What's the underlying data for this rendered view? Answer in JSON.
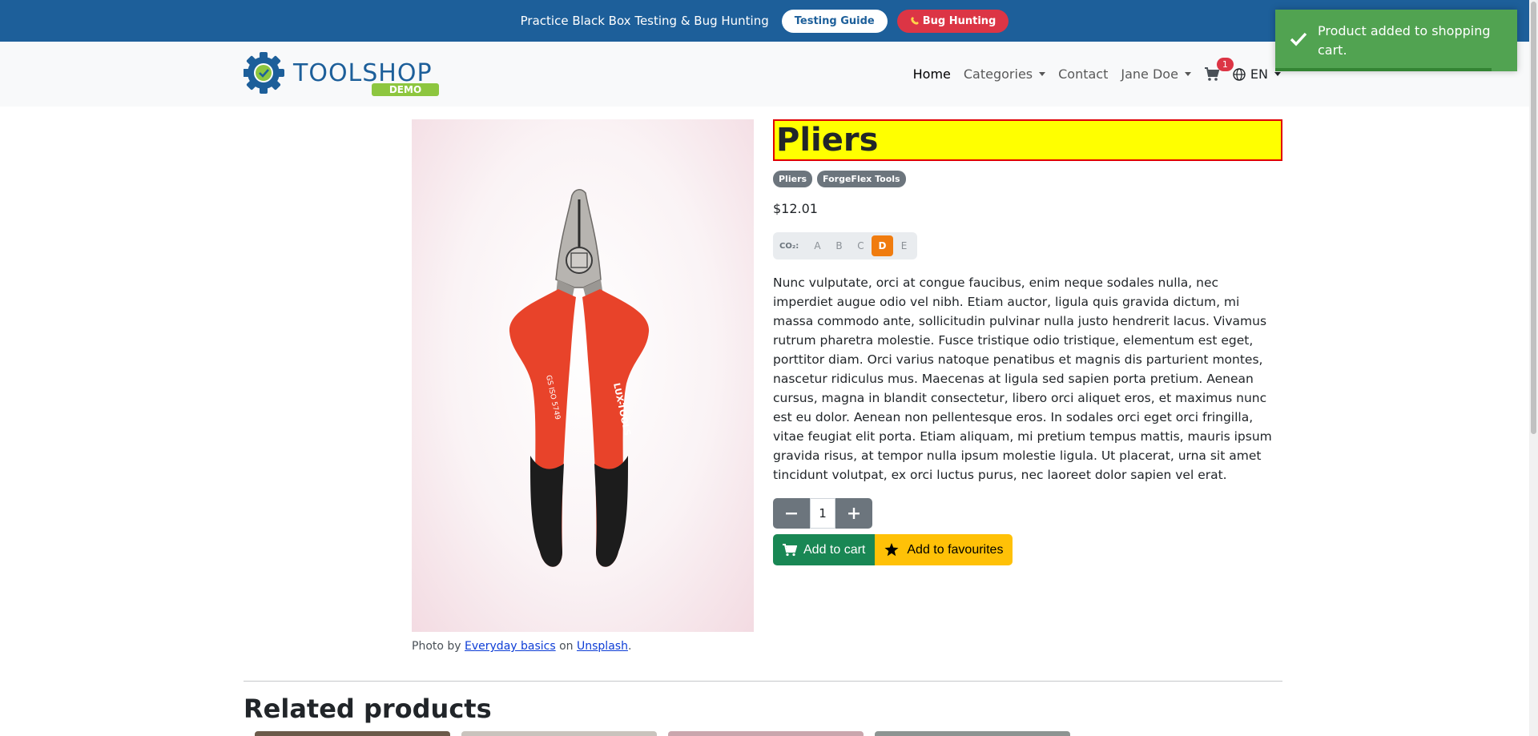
{
  "banner": {
    "text": "Practice Black Box Testing & Bug Hunting",
    "guide_label": "Testing Guide",
    "bug_label": "Bug Hunting"
  },
  "nav": {
    "home": "Home",
    "categories": "Categories",
    "contact": "Contact",
    "user": "Jane Doe",
    "cart_count": "1",
    "language": "EN"
  },
  "logo": {
    "primary": "TOOLSHOP",
    "tag": "DEMO"
  },
  "product": {
    "title": "Pliers",
    "badges": [
      "Pliers",
      "ForgeFlex Tools"
    ],
    "price": "$12.01",
    "co2_label": "CO₂:",
    "co2_grades": [
      "A",
      "B",
      "C",
      "D",
      "E"
    ],
    "co2_selected": "D",
    "description": "Nunc vulputate, orci at congue faucibus, enim neque sodales nulla, nec imperdiet augue odio vel nibh. Etiam auctor, ligula quis gravida dictum, mi massa commodo ante, sollicitudin pulvinar nulla justo hendrerit lacus. Vivamus rutrum pharetra molestie. Fusce tristique odio tristique, elementum est eget, porttitor diam. Orci varius natoque penatibus et magnis dis parturient montes, nascetur ridiculus mus. Maecenas at ligula sed sapien porta pretium. Aenean cursus, magna in blandit consectetur, libero orci aliquet eros, et maximus nunc est eu dolor. Aenean non pellentesque eros. In sodales orci eget orci fringilla, vitae feugiat elit porta. Etiam aliquam, mi pretium tempus mattis, mauris ipsum gravida risus, at tempor nulla ipsum molestie ligula. Ut placerat, urna sit amet tincidunt volutpat, ex orci luctus purus, nec laoreet dolor sapien vel erat.",
    "quantity": "1",
    "add_to_cart": "Add to cart",
    "add_to_favourites": "Add to favourites",
    "image_handle_lettering": [
      "LUX-TOOLS",
      "GS ISO 5749"
    ],
    "credit": {
      "prefix": "Photo by ",
      "author": "Everyday basics",
      "middle": " on ",
      "site": "Unsplash",
      "suffix": "."
    }
  },
  "related": {
    "title": "Related products"
  },
  "toast": {
    "message": "Product added to shopping cart."
  },
  "colors": {
    "banner": "#1d5f9a",
    "toast": "#51a351",
    "title_highlight": "#ffff00",
    "title_border": "#e00000",
    "co2_active": "#f07c0f",
    "cart_button": "#198754",
    "fav_button": "#ffc107"
  }
}
